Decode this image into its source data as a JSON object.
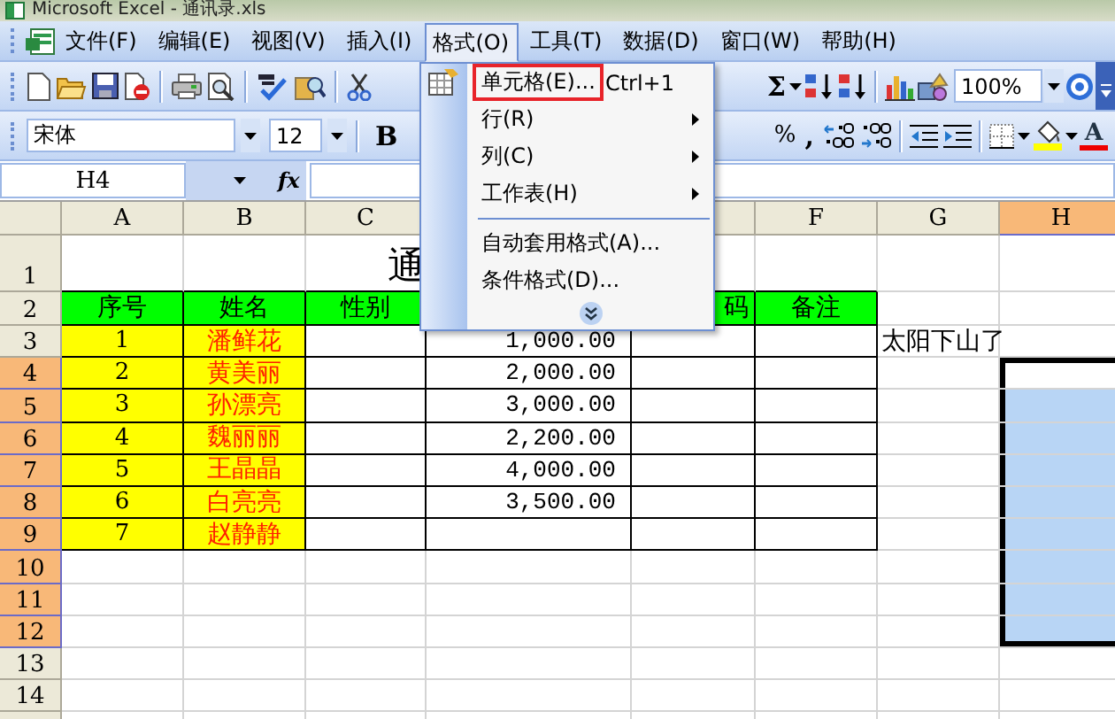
{
  "window": {
    "title": "Microsoft Excel - 通讯录.xls"
  },
  "menu_bar": [
    {
      "label": "文件(F)",
      "selected": false
    },
    {
      "label": "编辑(E)",
      "selected": false
    },
    {
      "label": "视图(V)",
      "selected": false
    },
    {
      "label": "插入(I)",
      "selected": false
    },
    {
      "label": "格式(O)",
      "selected": true
    },
    {
      "label": "工具(T)",
      "selected": false
    },
    {
      "label": "数据(D)",
      "selected": false
    },
    {
      "label": "窗口(W)",
      "selected": false
    },
    {
      "label": "帮助(H)",
      "selected": false
    }
  ],
  "standard_toolbar": {
    "sum": "Σ",
    "zoom": "100%"
  },
  "formatting_toolbar": {
    "font": "宋体",
    "size": "12",
    "bold": "B",
    "percent": "%",
    "comma": ",",
    "font_color": "A"
  },
  "formula_bar": {
    "name_box": "H4",
    "function": "fx"
  },
  "format_menu": [
    {
      "kind": "item",
      "label": "单元格(E)...",
      "shortcut": "Ctrl+1",
      "submenu": false,
      "icon": true,
      "highlighted": true
    },
    {
      "kind": "item",
      "label": "行(R)",
      "submenu": true,
      "icon": false,
      "highlighted": false
    },
    {
      "kind": "item",
      "label": "列(C)",
      "submenu": true,
      "icon": false,
      "highlighted": false
    },
    {
      "kind": "item",
      "label": "工作表(H)",
      "submenu": true,
      "icon": false,
      "highlighted": false
    },
    {
      "kind": "separator"
    },
    {
      "kind": "item",
      "label": "自动套用格式(A)...",
      "submenu": false,
      "icon": false,
      "highlighted": false
    },
    {
      "kind": "item",
      "label": "条件格式(D)...",
      "submenu": false,
      "icon": false,
      "highlighted": false
    },
    {
      "kind": "expand"
    }
  ],
  "sheet": {
    "columns": [
      {
        "label": "A",
        "selected": false
      },
      {
        "label": "B",
        "selected": false
      },
      {
        "label": "C",
        "selected": false
      },
      {},
      {},
      {
        "label": "F",
        "selected": false
      },
      {
        "label": "G",
        "selected": false
      },
      {
        "label": "H",
        "selected": true
      }
    ],
    "rows": [
      {
        "number": "1",
        "kind": "title",
        "selected": false,
        "cells": {
          "c": "通"
        }
      },
      {
        "number": "2",
        "kind": "header",
        "selected": false,
        "cells": {
          "a": "序号",
          "b": "姓名",
          "c": "性别",
          "e": "码",
          "f": "备注"
        }
      },
      {
        "number": "3",
        "kind": "data",
        "selected": false,
        "cells": {
          "a": "1",
          "b": "潘鲜花",
          "d": "1,000.00",
          "g": "太阳下山了"
        }
      },
      {
        "number": "4",
        "kind": "data",
        "selected": true,
        "cells": {
          "a": "2",
          "b": "黄美丽",
          "d": "2,000.00"
        }
      },
      {
        "number": "5",
        "kind": "data",
        "selected": true,
        "cells": {
          "a": "3",
          "b": "孙漂亮",
          "d": "3,000.00"
        }
      },
      {
        "number": "6",
        "kind": "data",
        "selected": true,
        "cells": {
          "a": "4",
          "b": "魏丽丽",
          "d": "2,200.00"
        }
      },
      {
        "number": "7",
        "kind": "data",
        "selected": true,
        "cells": {
          "a": "5",
          "b": "王晶晶",
          "d": "4,000.00"
        }
      },
      {
        "number": "8",
        "kind": "data",
        "selected": true,
        "cells": {
          "a": "6",
          "b": "白亮亮",
          "d": "3,500.00"
        }
      },
      {
        "number": "9",
        "kind": "data",
        "selected": true,
        "cells": {
          "a": "7",
          "b": "赵静静"
        }
      },
      {
        "number": "10",
        "kind": "blank",
        "selected": true,
        "cells": {}
      },
      {
        "number": "11",
        "kind": "blank",
        "selected": true,
        "cells": {}
      },
      {
        "number": "12",
        "kind": "blank",
        "selected": true,
        "cells": {}
      },
      {
        "number": "13",
        "kind": "blank",
        "selected": false,
        "cells": {}
      },
      {
        "number": "14",
        "kind": "blank",
        "selected": false,
        "cells": {}
      }
    ]
  }
}
